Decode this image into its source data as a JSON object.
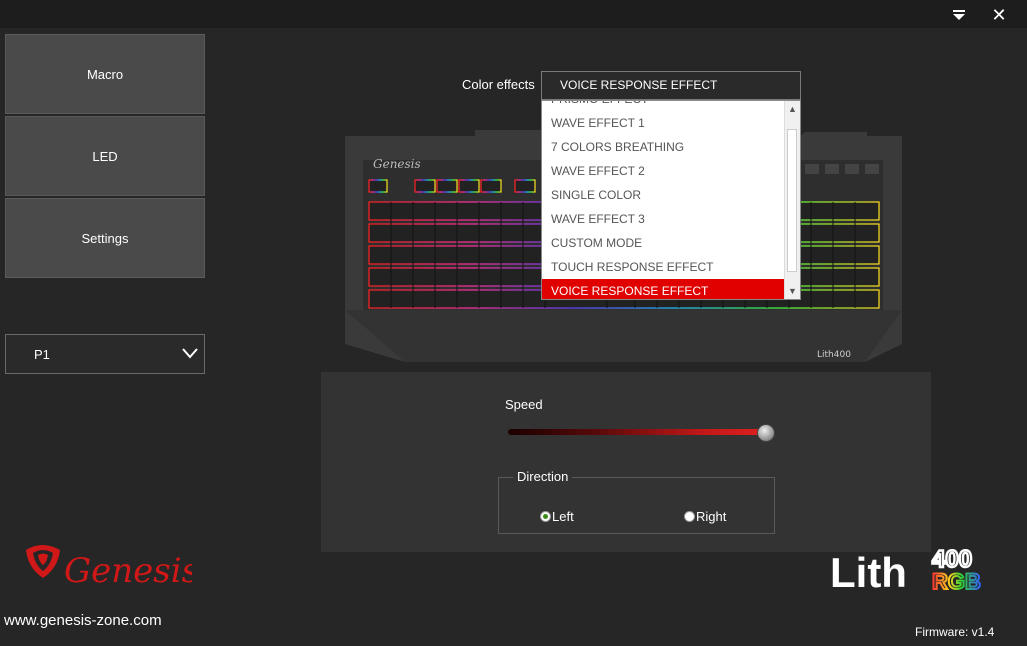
{
  "window": {
    "minimize_icon": "collapse-icon",
    "close_label": "✕"
  },
  "nav": {
    "items": [
      {
        "label": "Macro"
      },
      {
        "label": "LED"
      },
      {
        "label": "Settings"
      }
    ]
  },
  "profile": {
    "selected": "P1"
  },
  "color_effects": {
    "label": "Color effects",
    "selected": "VOICE RESPONSE EFFECT",
    "options": [
      "PRISMO EFFECT",
      "WAVE EFFECT 1",
      "7 COLORS BREATHING",
      "WAVE EFFECT 2",
      "SINGLE COLOR",
      "WAVE EFFECT 3",
      "CUSTOM MODE",
      "TOUCH RESPONSE EFFECT",
      "VOICE RESPONSE EFFECT"
    ]
  },
  "speed": {
    "label": "Speed",
    "value_fraction": 0.99
  },
  "direction": {
    "label": "Direction",
    "options": [
      {
        "label": "Left",
        "checked": true
      },
      {
        "label": "Right",
        "checked": false
      }
    ]
  },
  "footer": {
    "url": "www.genesis-zone.com",
    "firmware": "Firmware: v1.4"
  },
  "brand": {
    "logo_text": "Genesis",
    "product_text": "Lith",
    "product_number": "400",
    "product_suffix": "RGB",
    "accent": "#e00000"
  }
}
